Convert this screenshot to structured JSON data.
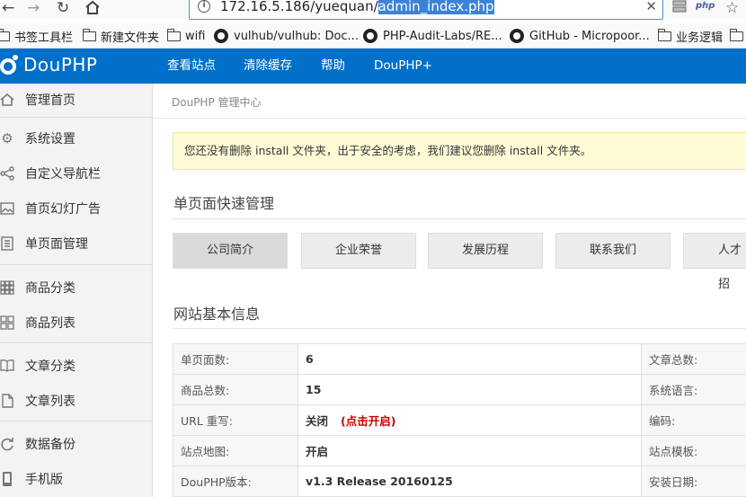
{
  "browser": {
    "url_prefix": "172.16.5.186/yuequan/",
    "url_selected": "admin_index.php",
    "php_badge": "php"
  },
  "bookmarks": [
    {
      "label": "书签工具栏",
      "icon": "folder-icon"
    },
    {
      "label": "新建文件夹",
      "icon": "folder-icon"
    },
    {
      "label": "wifi",
      "icon": "folder-icon"
    },
    {
      "label": "vulhub/vulhub: Doc...",
      "icon": "github-icon"
    },
    {
      "label": "PHP-Audit-Labs/RE...",
      "icon": "github-icon"
    },
    {
      "label": "GitHub - Micropoor...",
      "icon": "github-icon"
    },
    {
      "label": "业务逻辑",
      "icon": "folder-icon"
    }
  ],
  "header": {
    "logo_text": "DouPHP",
    "nav": [
      "查看站点",
      "清除缓存",
      "帮助",
      "DouPHP+"
    ]
  },
  "sidebar": {
    "items": [
      {
        "label": "管理首页",
        "icon": "home-icon"
      },
      {
        "label": "系统设置",
        "icon": "gear-icon"
      },
      {
        "label": "自定义导航栏",
        "icon": "share-icon"
      },
      {
        "label": "首页幻灯广告",
        "icon": "image-icon"
      },
      {
        "label": "单页面管理",
        "icon": "document-icon"
      },
      {
        "label": "商品分类",
        "icon": "grid-icon"
      },
      {
        "label": "商品列表",
        "icon": "grid-icon"
      },
      {
        "label": "文章分类",
        "icon": "book-icon"
      },
      {
        "label": "文章列表",
        "icon": "file-icon"
      },
      {
        "label": "数据备份",
        "icon": "backup-icon"
      },
      {
        "label": "手机版",
        "icon": "mobile-icon"
      }
    ]
  },
  "main": {
    "breadcrumb": "DouPHP 管理中心",
    "alert": "您还没有删除 install 文件夹，出于安全的考虑，我们建议您删除 install 文件夹。",
    "quick_title": "单页面快速管理",
    "quick_buttons": [
      "公司简介",
      "企业荣誉",
      "发展历程",
      "联系我们",
      "人才招"
    ],
    "info_title": "网站基本信息",
    "info_rows": [
      {
        "label": "单页面数:",
        "value": "6",
        "label2": "文章总数:"
      },
      {
        "label": "商品总数:",
        "value": "15",
        "label2": "系统语言:"
      },
      {
        "label": "URL 重写:",
        "value": "关闭",
        "link": "(点击开启)",
        "label2": "编码:"
      },
      {
        "label": "站点地图:",
        "value": "开启",
        "label2": "站点模板:"
      },
      {
        "label": "DouPHP版本:",
        "value": "v1.3 Release 20160125",
        "label2": "安装日期:"
      }
    ]
  },
  "colors": {
    "header_bg": "#0070c9",
    "alert_bg": "#fffbd6",
    "link_red": "#cc0000"
  }
}
